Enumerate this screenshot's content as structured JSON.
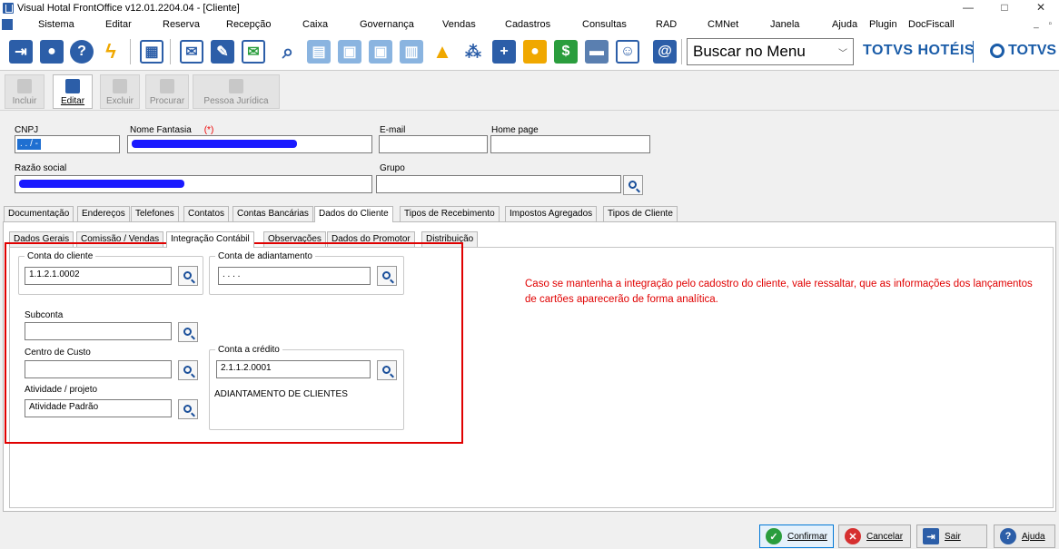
{
  "window": {
    "title": "Visual Hotal FrontOffice v12.01.2204.04 - [Cliente]",
    "controls": [
      "—",
      "□",
      "✕"
    ]
  },
  "menu": {
    "items": [
      "Sistema",
      "Editar",
      "Reserva",
      "Recepção",
      "Caixa",
      "Governança",
      "Vendas",
      "Cadastros",
      "Consultas",
      "RAD",
      "CMNet",
      "Janela",
      "Ajuda",
      "Plugin",
      "DocFiscall"
    ],
    "mdi_controls": "_ ▫"
  },
  "toolbar": {
    "menu_search_value": "Buscar no Menu",
    "brand_primary": "TOTVS HOTÉIS",
    "brand_secondary": "TOTVS"
  },
  "actions": {
    "incluir": "Incluir",
    "editar": "Editar",
    "excluir": "Excluir",
    "procurar": "Procurar",
    "pessoa_juridica": "Pessoa Jurídica"
  },
  "form": {
    "cnpj_label": "CNPJ",
    "cnpj_value": ". . / -",
    "nome_fantasia_label": "Nome Fantasia",
    "required_mark": "(*)",
    "email_label": "E-mail",
    "home_page_label": "Home page",
    "razao_social_label": "Razão social",
    "grupo_label": "Grupo"
  },
  "outer_tabs": [
    "Documentação",
    "Endereços",
    "Telefones",
    "Contatos",
    "Contas Bancárias",
    "Dados do Cliente",
    "Tipos de Recebimento",
    "Impostos Agregados",
    "Tipos de Cliente"
  ],
  "inner_tabs": [
    "Dados Gerais",
    "Comissão / Vendas",
    "Integração Contábil",
    "Observações",
    "Dados do Promotor",
    "Distribuição"
  ],
  "integracao": {
    "conta_cliente_label": "Conta do cliente",
    "conta_cliente_value": "1.1.2.1.0002",
    "conta_adiantamento_label": "Conta de adiantamento",
    "conta_adiantamento_value": ". . . .",
    "subconta_label": "Subconta",
    "subconta_value": "",
    "centro_custo_label": "Centro de Custo",
    "centro_custo_value": "",
    "conta_credito_label": "Conta a crédito",
    "conta_credito_value": "2.1.1.2.0001",
    "conta_credito_desc": "ADIANTAMENTO DE CLIENTES",
    "atividade_label": "Atividade / projeto",
    "atividade_value": "Atividade Padrão"
  },
  "note": "Caso se mantenha a integração pelo cadostro do cliente, vale ressaltar, que as informações dos lançamentos de cartões aparecerão de forma analítica.",
  "buttons": {
    "confirmar": "Confirmar",
    "cancelar": "Cancelar",
    "sair": "Sair",
    "ajuda": "Ajuda"
  },
  "colors": {
    "accent": "#1a5ca8",
    "highlight": "#e00000",
    "selection": "#1f6fd1"
  }
}
